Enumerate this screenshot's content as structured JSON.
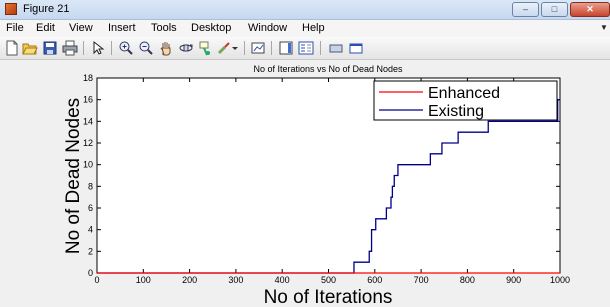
{
  "window": {
    "title": "Figure 21",
    "controls": {
      "minimize": "–",
      "maximize": "□",
      "close": "✕"
    }
  },
  "menu": {
    "items": [
      "File",
      "Edit",
      "View",
      "Insert",
      "Tools",
      "Desktop",
      "Window",
      "Help"
    ],
    "overflow": "▼"
  },
  "toolbar": {
    "buttons": [
      "new-figure-icon",
      "open-file-icon",
      "save-icon",
      "print-icon",
      "pointer-icon",
      "zoom-in-icon",
      "zoom-out-icon",
      "pan-icon",
      "rotate-3d-icon",
      "data-cursor-icon",
      "brush-icon",
      "colorbar-icon",
      "legend-icon",
      "hide-plot-tools-icon",
      "show-plot-tools-icon"
    ]
  },
  "colors": {
    "enhanced": "#ff0000",
    "existing": "#00008b",
    "plot_background": "#ffffff",
    "figure_background": "#f0f0f0"
  },
  "chart_data": {
    "type": "line",
    "title": "No of Iterations vs No of Dead Nodes",
    "xlabel": "No of Iterations",
    "ylabel": "No of Dead Nodes",
    "xlim": [
      0,
      1000
    ],
    "ylim": [
      0,
      18
    ],
    "xticks": [
      0,
      100,
      200,
      300,
      400,
      500,
      600,
      700,
      800,
      900,
      1000
    ],
    "yticks": [
      0,
      2,
      4,
      6,
      8,
      10,
      12,
      14,
      16,
      18
    ],
    "grid": false,
    "legend": {
      "position": "top-right",
      "entries": [
        "Enhanced",
        "Existing"
      ]
    },
    "series": [
      {
        "name": "Enhanced",
        "color": "#ff0000",
        "x": [
          0,
          1000
        ],
        "y": [
          0,
          0
        ]
      },
      {
        "name": "Existing",
        "color": "#00008b",
        "x": [
          0,
          555,
          555,
          588,
          588,
          593,
          593,
          602,
          602,
          610,
          610,
          625,
          625,
          635,
          635,
          638,
          638,
          642,
          642,
          646,
          646,
          650,
          650,
          660,
          660,
          700,
          700,
          720,
          720,
          745,
          745,
          770,
          770,
          780,
          780,
          805,
          805,
          845,
          845,
          860,
          860,
          880,
          880,
          995,
          995,
          1000
        ],
        "y": [
          0,
          0,
          1,
          1,
          2,
          2,
          4,
          4,
          5,
          5,
          5,
          5,
          6,
          6,
          7,
          7,
          8,
          8,
          9,
          9,
          9,
          9,
          10,
          10,
          10,
          10,
          10,
          10,
          11,
          11,
          12,
          12,
          12,
          12,
          13,
          13,
          13,
          13,
          14,
          14,
          14,
          14,
          14,
          14,
          16,
          16
        ]
      }
    ]
  }
}
